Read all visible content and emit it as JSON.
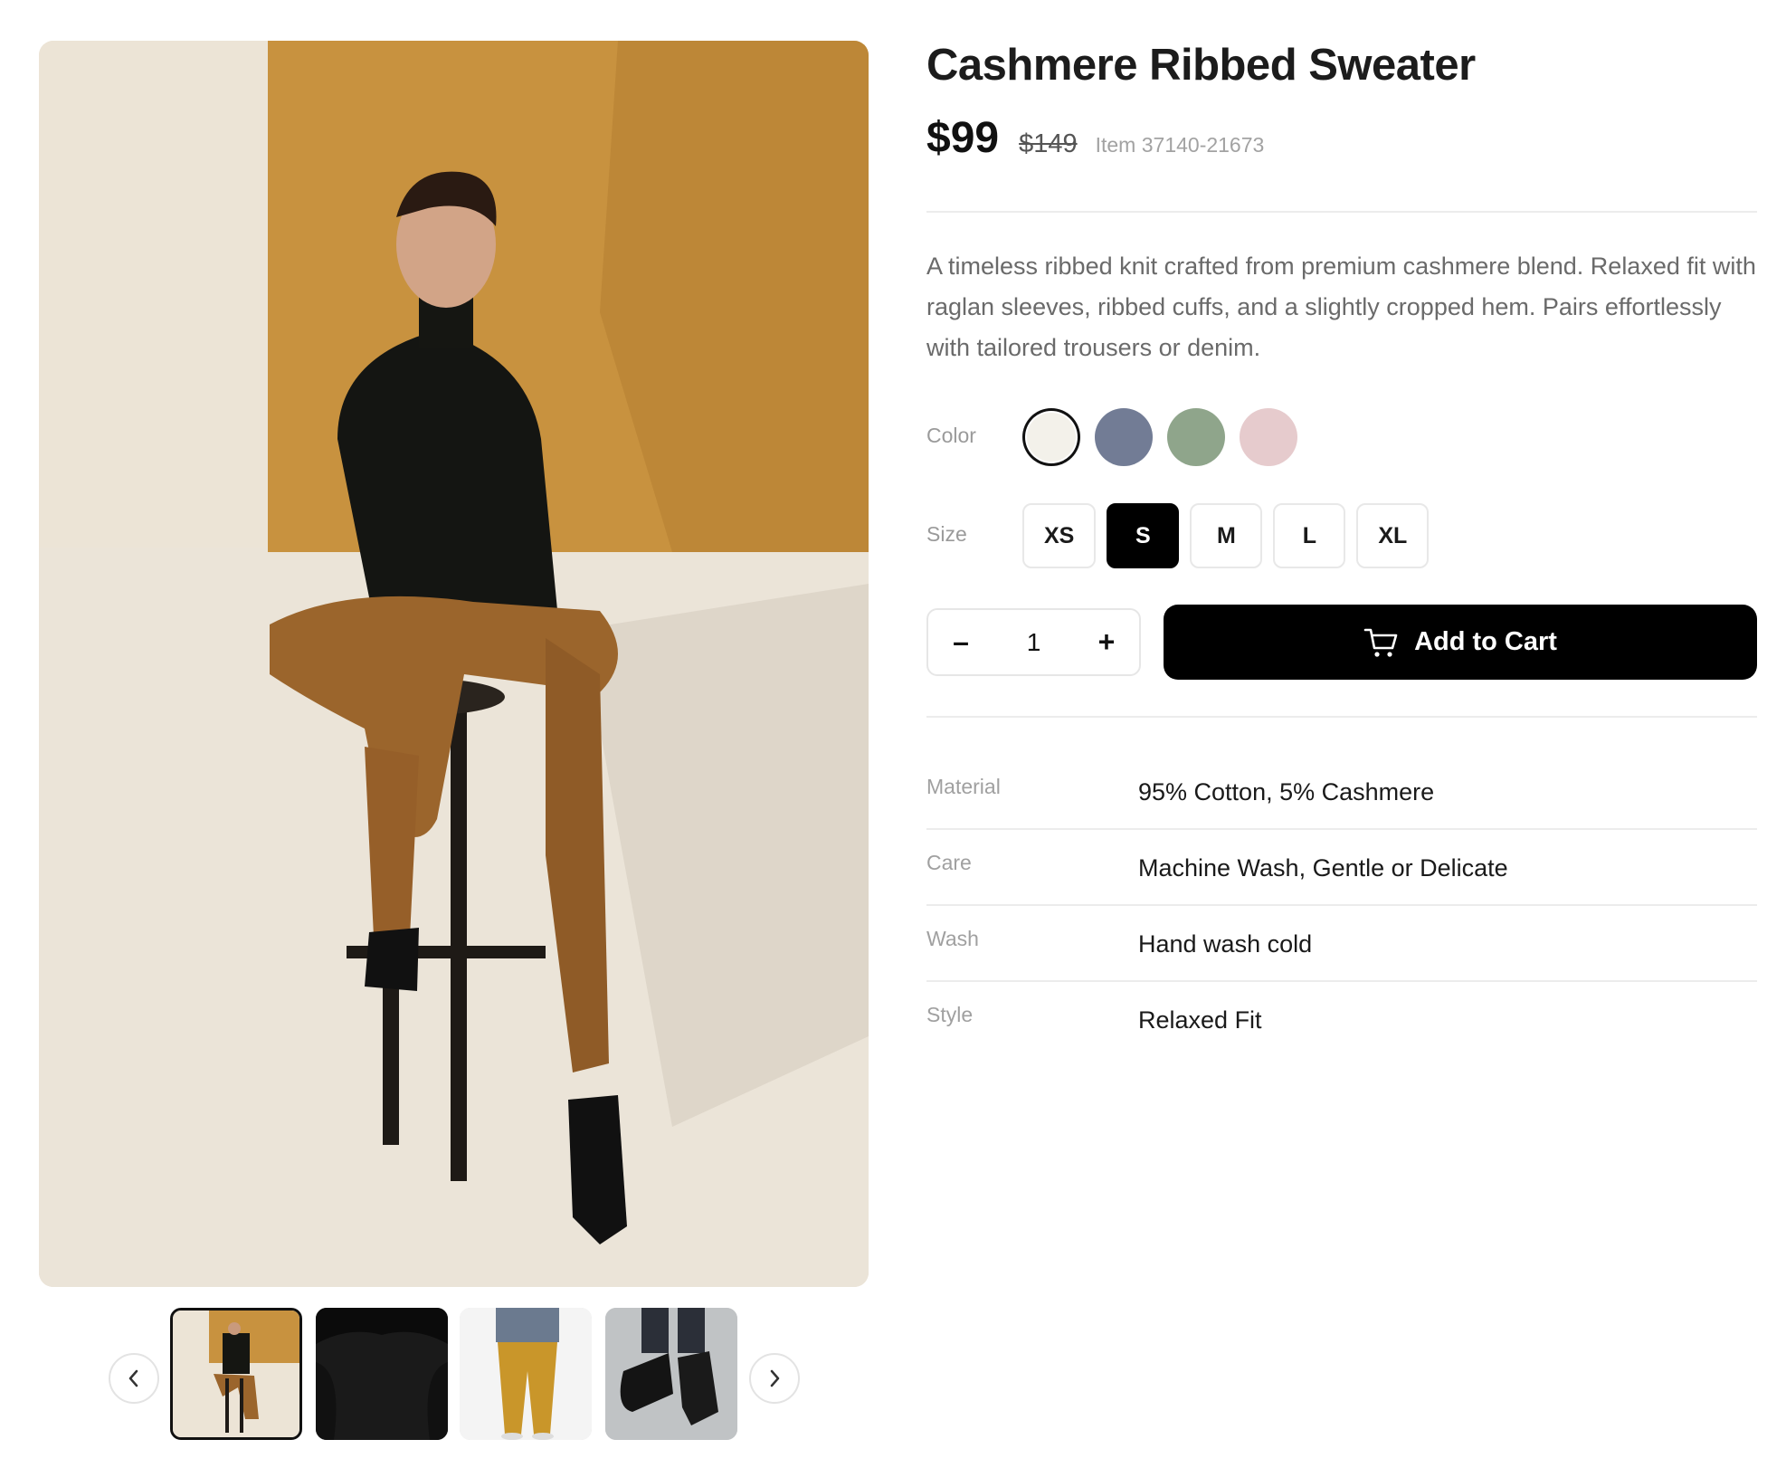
{
  "product": {
    "title": "Cashmere Ribbed Sweater",
    "price": "$99",
    "original_price": "$149",
    "item_number": "Item 37140-21673",
    "description": "A timeless ribbed knit crafted from premium cashmere blend. Relaxed fit with raglan sleeves, ribbed cuffs, and a slightly cropped hem. Pairs effortlessly with tailored trousers or denim."
  },
  "options": {
    "color_label": "Color",
    "colors": [
      "#f3f1ea",
      "#727c95",
      "#8fa58b",
      "#e6cbcd"
    ],
    "selected_color_index": 0,
    "size_label": "Size",
    "sizes": [
      "XS",
      "S",
      "M",
      "L",
      "XL"
    ],
    "selected_size": "S"
  },
  "cart": {
    "quantity": "1",
    "decrement_label": "–",
    "increment_label": "+",
    "add_label": "Add to Cart",
    "cart_icon": "cart-icon"
  },
  "specs": [
    {
      "key": "Material",
      "value": "95% Cotton, 5% Cashmere"
    },
    {
      "key": "Care",
      "value": "Machine Wash, Gentle or Delicate"
    },
    {
      "key": "Wash",
      "value": "Hand wash cold"
    },
    {
      "key": "Style",
      "value": "Relaxed Fit"
    }
  ],
  "gallery": {
    "prev_icon": "chevron-left-icon",
    "next_icon": "chevron-right-icon",
    "active_thumb_index": 0,
    "thumb_count": 4
  },
  "colors": {
    "accent": "#000000",
    "text_muted": "#9a9a9a",
    "divider": "#ececec"
  }
}
